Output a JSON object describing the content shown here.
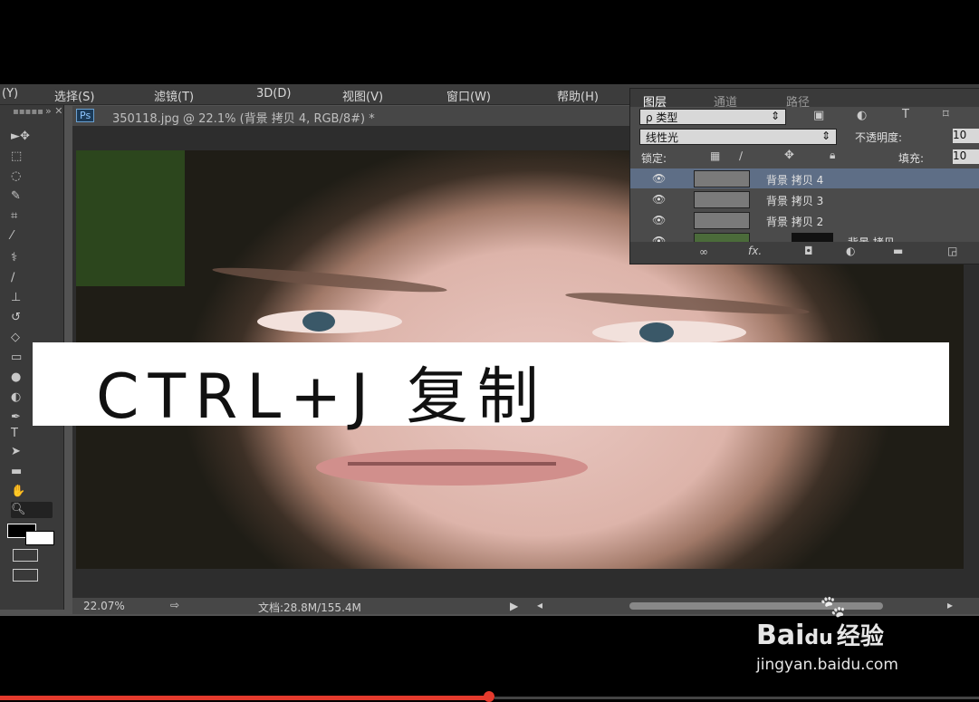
{
  "menubar": {
    "items": [
      "(Y)",
      "选择(S)",
      "滤镜(T)",
      "3D(D)",
      "视图(V)",
      "窗口(W)",
      "帮助(H)"
    ]
  },
  "document_tab": {
    "app_badge": "Ps",
    "title": "350118.jpg @ 22.1% (背景 拷贝 4, RGB/8#) *"
  },
  "toolbar": {
    "icons": [
      "move-icon",
      "marquee-icon",
      "lasso-icon",
      "quick-select-icon",
      "crop-icon",
      "eyedropper-icon",
      "healing-brush-icon",
      "brush-icon",
      "stamp-icon",
      "history-brush-icon",
      "eraser-icon",
      "gradient-icon",
      "blur-icon",
      "dodge-icon",
      "pen-icon",
      "type-icon",
      "path-select-icon",
      "shape-icon",
      "hand-icon",
      "zoom-icon"
    ]
  },
  "layers_panel": {
    "tabs": [
      "图层",
      "通道",
      "路径"
    ],
    "filter_label": "ρ 类型",
    "blend_mode": "线性光",
    "opacity_label": "不透明度:",
    "opacity_value": "10",
    "lock_label": "锁定:",
    "fill_label": "填充:",
    "fill_value": "10",
    "layers": [
      {
        "name": "背景 拷贝 4",
        "selected": true
      },
      {
        "name": "背景 拷贝 3",
        "selected": false
      },
      {
        "name": "背景 拷贝 2",
        "selected": false
      },
      {
        "name": "背景 拷贝",
        "selected": false
      }
    ]
  },
  "statusbar": {
    "zoom": "22.07%",
    "doc_info": "文档:28.8M/155.4M"
  },
  "caption": {
    "text": "CTRL+J 复制"
  },
  "watermark": {
    "brand_left": "Bai",
    "brand_mid": "du",
    "brand_cn": "经验",
    "url": "jingyan.baidu.com"
  },
  "player": {
    "progress_fraction": 0.5
  },
  "colors": {
    "caption_bg": "#ffffff",
    "progress": "#e43a2d",
    "layer_selected": "#5e6e86"
  }
}
